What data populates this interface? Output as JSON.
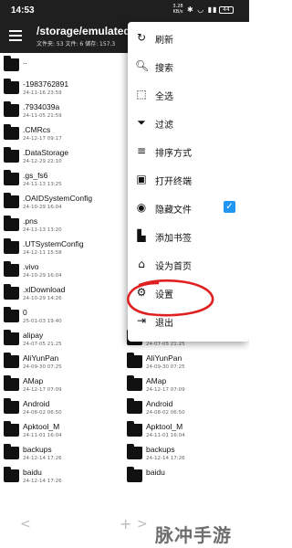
{
  "status_bar": {
    "time": "14:53",
    "speed": "3.28 KB/s",
    "icons": "✱ ◡ ▮▮",
    "battery": "44"
  },
  "app_bar": {
    "path": "/storage/emulated",
    "info": "文件夹: 53  文件: 6  储存: 157.3"
  },
  "files_left": [
    {
      "name": "..",
      "date": ""
    },
    {
      "name": "-1983762891",
      "date": "24-11-16 23:59"
    },
    {
      "name": ".7934039a",
      "date": "24-11-05 21:59"
    },
    {
      "name": ".CMRcs",
      "date": "24-12-17 09:17"
    },
    {
      "name": ".DataStorage",
      "date": "24-12-29 22:10"
    },
    {
      "name": ".gs_fs6",
      "date": "24-11-13 13:25"
    },
    {
      "name": ".OAIDSystemConfig",
      "date": "24-10-29 16:04"
    },
    {
      "name": ".pns",
      "date": "24-11-13 13:20"
    },
    {
      "name": ".UTSystemConfig",
      "date": "24-12-11 15:58"
    },
    {
      "name": ".vivo",
      "date": "24-10-29 16:04"
    },
    {
      "name": ".xlDownload",
      "date": "24-10-29 14:26"
    },
    {
      "name": "0",
      "date": "25-01-03 19:40"
    },
    {
      "name": "alipay",
      "date": "24-07-05 21:25"
    },
    {
      "name": "AliYunPan",
      "date": "24-09-30 07:25"
    },
    {
      "name": "AMap",
      "date": "24-12-17 07:09"
    },
    {
      "name": "Android",
      "date": "24-08-02 06:50"
    },
    {
      "name": "Apktool_M",
      "date": "24-11-01 16:04"
    },
    {
      "name": "backups",
      "date": "24-12-14 17:26"
    },
    {
      "name": "baidu",
      "date": "24-12-14 17:26"
    }
  ],
  "files_right": [
    {
      "name": "alipay",
      "date": "24-07-05 21:25"
    },
    {
      "name": "AliYunPan",
      "date": "24-09-30 07:25"
    },
    {
      "name": "AMap",
      "date": "24-12-17 07:09"
    },
    {
      "name": "Android",
      "date": "24-08-02 06:50"
    },
    {
      "name": "Apktool_M",
      "date": "24-11-01 16:04"
    },
    {
      "name": "backups",
      "date": "24-12-14 17:26"
    },
    {
      "name": "baidu",
      "date": ""
    }
  ],
  "menu": {
    "items": [
      {
        "icon": "refresh-icon",
        "glyph": "↻",
        "label": "刷新"
      },
      {
        "icon": "search-icon",
        "glyph": "🔍︎",
        "label": "搜索"
      },
      {
        "icon": "select-all-icon",
        "glyph": "⬚",
        "label": "全选"
      },
      {
        "icon": "filter-icon",
        "glyph": "⏷",
        "label": "过滤"
      },
      {
        "icon": "sort-icon",
        "glyph": "≡",
        "label": "排序方式"
      },
      {
        "icon": "terminal-icon",
        "glyph": "▣",
        "label": "打开终端"
      },
      {
        "icon": "eye-icon",
        "glyph": "◉",
        "label": "隐藏文件"
      },
      {
        "icon": "bookmark-icon",
        "glyph": "▙",
        "label": "添加书签"
      },
      {
        "icon": "home-icon",
        "glyph": "⌂",
        "label": "设为首页"
      },
      {
        "icon": "gear-icon",
        "glyph": "⚙",
        "label": "设置"
      },
      {
        "icon": "exit-icon",
        "glyph": "⇥",
        "label": "退出"
      }
    ],
    "hidden_files_checked": "✓"
  },
  "bottom_nav": {
    "back": "<",
    "add": "+",
    "forward": ">"
  },
  "watermark": "脉冲手游网",
  "colors": {
    "bar_bg": "#1f1f1f",
    "checkbox": "#2196f3",
    "annotation": "#e02020"
  }
}
